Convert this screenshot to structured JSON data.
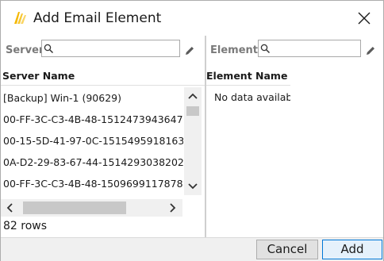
{
  "dialog": {
    "title": "Add Email Element",
    "icon": "lightning-wing-icon",
    "accent_color": "#f5b800"
  },
  "server_pane": {
    "search_label": "Server",
    "search_value": "",
    "column_header": "Server Name",
    "rows": [
      "[Backup] Win-1 (90629)",
      "00-FF-3C-C3-4B-48-1512473943647",
      "00-15-5D-41-97-0C-1515495918163",
      "0A-D2-29-83-67-44-1514293038202",
      "00-FF-3C-C3-4B-48-1509699117878"
    ],
    "row_count": "82 rows"
  },
  "elements_pane": {
    "search_label": "Elements",
    "search_value": "",
    "column_header": "Element Name",
    "empty_message": "No data available"
  },
  "footer": {
    "cancel_label": "Cancel",
    "add_label": "Add"
  }
}
